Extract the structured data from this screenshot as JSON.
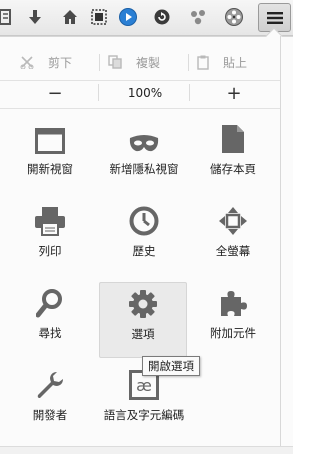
{
  "toolbar": {
    "icons": [
      "bookmarks-list-icon",
      "download-icon",
      "home-icon",
      "screenshot-icon",
      "media-play-icon",
      "history-back-icon",
      "social-share-icon",
      "film-reel-icon"
    ],
    "menu_icon": "hamburger-icon"
  },
  "edit": {
    "cut": "剪下",
    "copy": "複製",
    "paste": "貼上"
  },
  "zoom": {
    "minus": "−",
    "value": "100%",
    "plus": "+"
  },
  "grid": [
    {
      "label": "開新視窗",
      "icon": "new-window-icon"
    },
    {
      "label": "新增隱私視窗",
      "icon": "private-mask-icon"
    },
    {
      "label": "儲存本頁",
      "icon": "save-page-icon"
    },
    {
      "label": "列印",
      "icon": "printer-icon"
    },
    {
      "label": "歷史",
      "icon": "history-clock-icon"
    },
    {
      "label": "全螢幕",
      "icon": "fullscreen-icon"
    },
    {
      "label": "尋找",
      "icon": "search-icon"
    },
    {
      "label": "選項",
      "icon": "gear-icon"
    },
    {
      "label": "附加元件",
      "icon": "puzzle-icon"
    },
    {
      "label": "開發者",
      "icon": "wrench-icon"
    },
    {
      "label": "語言及字元編碼",
      "icon": "ae-ligature-icon"
    }
  ],
  "tooltip": "開啟選項",
  "colors": {
    "icon_gray": "#6a6a6a",
    "disabled_gray": "#b9b9b9"
  }
}
